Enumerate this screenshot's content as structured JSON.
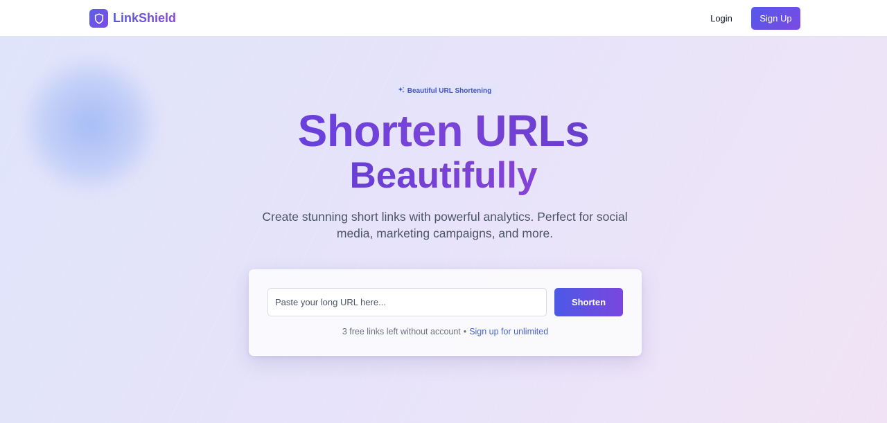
{
  "brand": {
    "name": "LinkShield",
    "icon": "shield-icon",
    "colors": {
      "primary": "#5459ea",
      "secondary": "#7b4ae3"
    }
  },
  "nav": {
    "login_label": "Login",
    "signup_label": "Sign Up"
  },
  "hero": {
    "badge_icon": "sparkles-icon",
    "badge_text": "Beautiful URL Shortening",
    "title": "Shorten URLs",
    "subtitle": "Beautifully",
    "description": "Create stunning short links with powerful analytics. Perfect for social media, marketing campaigns, and more."
  },
  "shortener": {
    "input_placeholder": "Paste your long URL here...",
    "input_value": "",
    "button_label": "Shorten",
    "free_links_text": "3 free links left without account",
    "separator": "•",
    "signup_link_text": "Sign up for unlimited"
  }
}
